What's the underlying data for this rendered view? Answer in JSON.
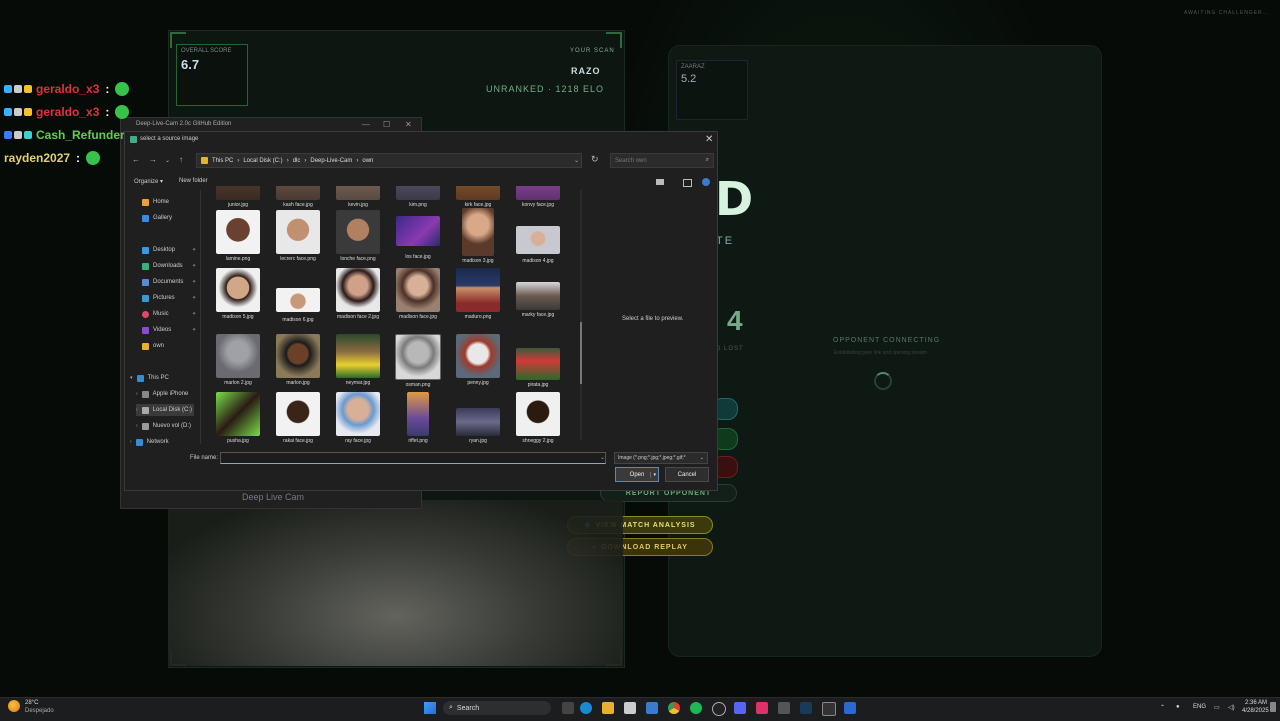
{
  "background_app": {
    "awaiting": "AWAITING CHALLENGER...",
    "overall_score_label": "OVERALL SCORE",
    "overall_score": "6.7",
    "your_scan_label": "YOUR SCAN",
    "player_name": "RAZO",
    "rank": "UNRANKED · 1218 ELO",
    "opponent_score_label": "ZAARAZ",
    "opponent_score": "5.2",
    "big_letter": "D",
    "big_letter_sub": "TE",
    "record_number": "4",
    "record_label": "D LOST",
    "opponent_connecting": "OPPONENT CONNECTING",
    "opponent_connecting_sub": "Establishing peer link and opening stream",
    "report_opponent": "REPORT OPPONENT",
    "view_match_analysis": "VIEW MATCH ANALYSIS",
    "download_replay": "DOWNLOAD REPLAY",
    "cam_label": "Deep Live Cam"
  },
  "parent_window": {
    "title": "Deep-Live-Cam 2.0c GitHub Edition"
  },
  "chat": [
    {
      "user": "geraldo_x3",
      "color": "#e0303a"
    },
    {
      "user": "geraldo_x3",
      "color": "#e0303a"
    },
    {
      "user": "Cash_Refunder",
      "color": "#5fd04a"
    },
    {
      "user": "rayden2027",
      "color": "#e0d070"
    }
  ],
  "dialog": {
    "title": "select a source image",
    "breadcrumb": [
      "This PC",
      "Local Disk (C:)",
      "dlc",
      "Deep-Live-Cam",
      "own"
    ],
    "search_placeholder": "Search own",
    "organize": "Organize",
    "new_folder": "New folder",
    "preview_text": "Select a file to preview.",
    "file_name_label": "File name:",
    "filter": "Image (*.png;*.jpg;*.jpeg;*.gif;*",
    "open": "Open",
    "cancel": "Cancel"
  },
  "sidebar": [
    {
      "label": "Home",
      "icon": "home-icon"
    },
    {
      "label": "Gallery",
      "icon": "gallery-icon"
    },
    {
      "label": "Desktop",
      "icon": "desktop-icon"
    },
    {
      "label": "Downloads",
      "icon": "downloads-icon"
    },
    {
      "label": "Documents",
      "icon": "documents-icon"
    },
    {
      "label": "Pictures",
      "icon": "pictures-icon"
    },
    {
      "label": "Music",
      "icon": "music-icon"
    },
    {
      "label": "Videos",
      "icon": "videos-icon"
    },
    {
      "label": "own",
      "icon": "folder-icon"
    },
    {
      "label": "This PC",
      "icon": "pc-icon"
    },
    {
      "label": "Apple iPhone",
      "icon": "phone-icon"
    },
    {
      "label": "Local Disk (C:)",
      "icon": "disk-icon"
    },
    {
      "label": "Nuevo vol (D:)",
      "icon": "disk-icon"
    },
    {
      "label": "Network",
      "icon": "network-icon"
    }
  ],
  "files": [
    "junior.jpg",
    "kash face.jpg",
    "kevin.jpg",
    "kim.png",
    "kirk face.jpg",
    "konvy face.jpg",
    "lamine.png",
    "lecrerc face.png",
    "lonche face.png",
    "los face.jpg",
    "madison 3.jpg",
    "madison 4.jpg",
    "madison 5.jpg",
    "madison 6.jpg",
    "madison face 2.jpg",
    "madison face.jpg",
    "maduro.png",
    "marky face.jpg",
    "marlon 2.jpg",
    "marlon.jpg",
    "neymar.jpg",
    "osman.png",
    "penny.jpg",
    "pirata.jpg",
    "pusha.jpg",
    "rakai face.jpg",
    "ray face.jpg",
    "riffet.png",
    "ryan.jpg",
    "shneggy 2.jpg"
  ],
  "taskbar": {
    "weather_temp": "28°C",
    "weather_desc": "Despejado",
    "search": "Search",
    "lang": "ENG",
    "time": "2:36 AM",
    "date": "4/28/2025"
  }
}
